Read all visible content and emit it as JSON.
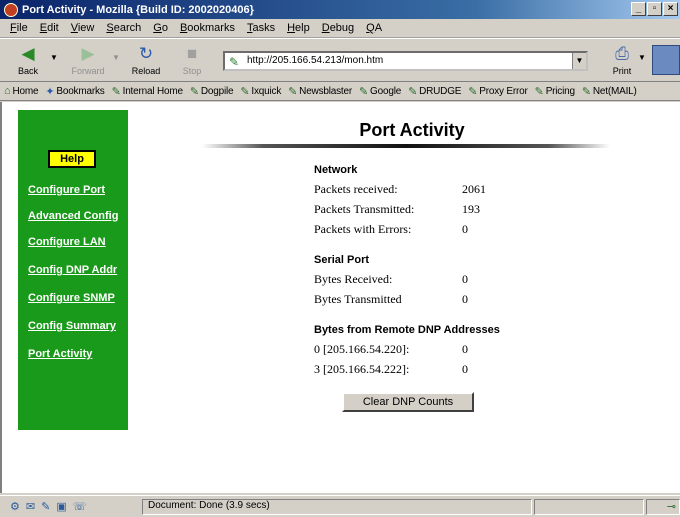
{
  "window": {
    "title": "Port Activity - Mozilla {Build ID: 2002020406}",
    "buttons": [
      "_",
      "▫",
      "×"
    ]
  },
  "menu": [
    "File",
    "Edit",
    "View",
    "Search",
    "Go",
    "Bookmarks",
    "Tasks",
    "Help",
    "Debug",
    "QA"
  ],
  "toolbar": {
    "back": "Back",
    "forward": "Forward",
    "reload": "Reload",
    "stop": "Stop",
    "print": "Print",
    "url": "http://205.166.54.213/mon.htm"
  },
  "bookmarks": [
    "Home",
    "Bookmarks",
    "Internal Home",
    "Dogpile",
    "Ixquick",
    "Newsblaster",
    "Google",
    "DRUDGE",
    "Proxy Error",
    "Pricing",
    "Net(MAIL)"
  ],
  "sidebar": {
    "help": "Help",
    "links": [
      "Configure Port",
      "Advanced Config",
      "Configure LAN",
      "Config DNP Addr",
      "Configure SNMP",
      "Config Summary",
      "Port Activity"
    ]
  },
  "page": {
    "title": "Port Activity",
    "network": {
      "heading": "Network",
      "rows": [
        {
          "label": "Packets received:",
          "value": "2061"
        },
        {
          "label": "Packets Transmitted:",
          "value": "193"
        },
        {
          "label": "Packets with Errors:",
          "value": "0"
        }
      ]
    },
    "serial": {
      "heading": "Serial Port",
      "rows": [
        {
          "label": "Bytes Received:",
          "value": "0"
        },
        {
          "label": "Bytes Transmitted",
          "value": "0"
        }
      ]
    },
    "dnp": {
      "heading": "Bytes from Remote DNP Addresses",
      "rows": [
        {
          "label": "0 [205.166.54.220]:",
          "value": "0"
        },
        {
          "label": "3 [205.166.54.222]:",
          "value": "0"
        }
      ]
    },
    "clear_button": "Clear DNP Counts"
  },
  "status": {
    "text": "Document: Done (3.9 secs)"
  },
  "colors": {
    "sidebar_bg": "#1a9a1a",
    "help_bg": "#ffff00",
    "titlebar": "#0a246a"
  }
}
